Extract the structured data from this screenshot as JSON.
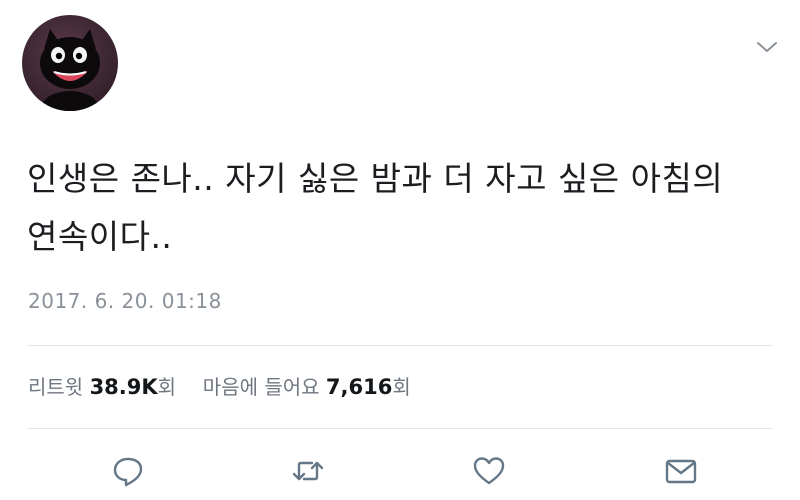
{
  "tweet": {
    "text": "인생은 존나.. 자기 싫은 밤과 더 자고 싶은 아침의 연속이다..",
    "timestamp": "2017. 6. 20. 01:18"
  },
  "stats": {
    "retweets_label": "리트윗",
    "retweets_count": "38.9K",
    "retweets_unit": "회",
    "likes_label": "마음에 들어요",
    "likes_count": "7,616",
    "likes_unit": "회"
  },
  "icons": {
    "menu": "chevron-down-icon",
    "reply": "reply-icon",
    "retweet": "retweet-icon",
    "like": "heart-icon",
    "dm": "envelope-icon"
  },
  "colors": {
    "icon": "#657786",
    "text": "#14171a",
    "muted": "#8a9199"
  }
}
